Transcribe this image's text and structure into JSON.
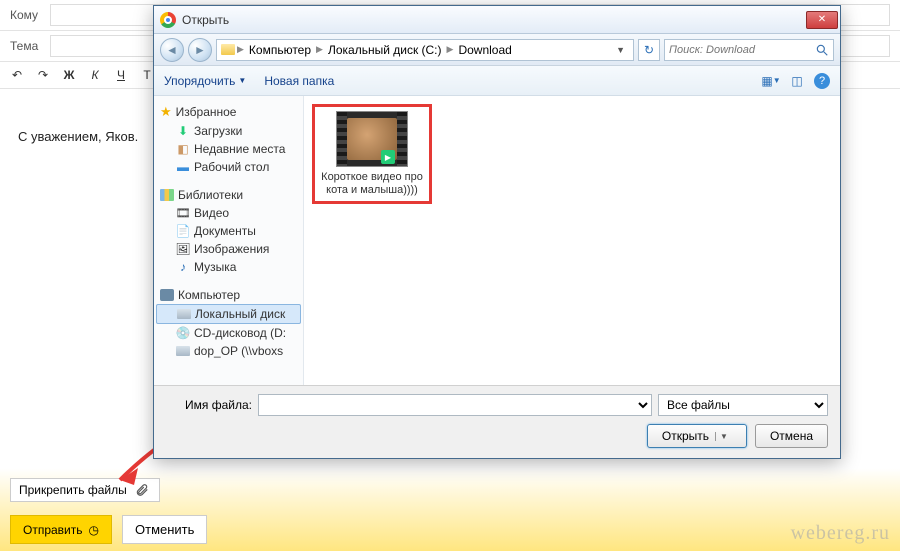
{
  "compose": {
    "to_label": "Кому",
    "subject_label": "Тема",
    "body_text": "С уважением, Яков.",
    "attach_label": "Прикрепить файлы",
    "send_label": "Отправить",
    "cancel_label": "Отменить",
    "fmt": {
      "bold": "Ж",
      "italic": "К",
      "under": "Ч",
      "strike": "Т"
    }
  },
  "dialog": {
    "title": "Открыть",
    "breadcrumb": {
      "seg1": "Компьютер",
      "seg2": "Локальный диск (C:)",
      "seg3": "Download"
    },
    "search_placeholder": "Поиск: Download",
    "cmdbar": {
      "organize": "Упорядочить",
      "new_folder": "Новая папка"
    },
    "nav": {
      "favorites": "Избранное",
      "fav_items": [
        "Загрузки",
        "Недавние места",
        "Рабочий стол"
      ],
      "libraries": "Библиотеки",
      "lib_items": [
        "Видео",
        "Документы",
        "Изображения",
        "Музыка"
      ],
      "computer": "Компьютер",
      "comp_items": [
        "Локальный диск",
        "CD-дисковод (D:",
        "dop_OP (\\\\vboxs"
      ]
    },
    "file": {
      "name": "Короткое видео про кота и малыша))))"
    },
    "footer": {
      "filename_label": "Имя файла:",
      "filter": "Все файлы",
      "open": "Открыть",
      "cancel": "Отмена"
    }
  },
  "watermark": "webereg.ru"
}
